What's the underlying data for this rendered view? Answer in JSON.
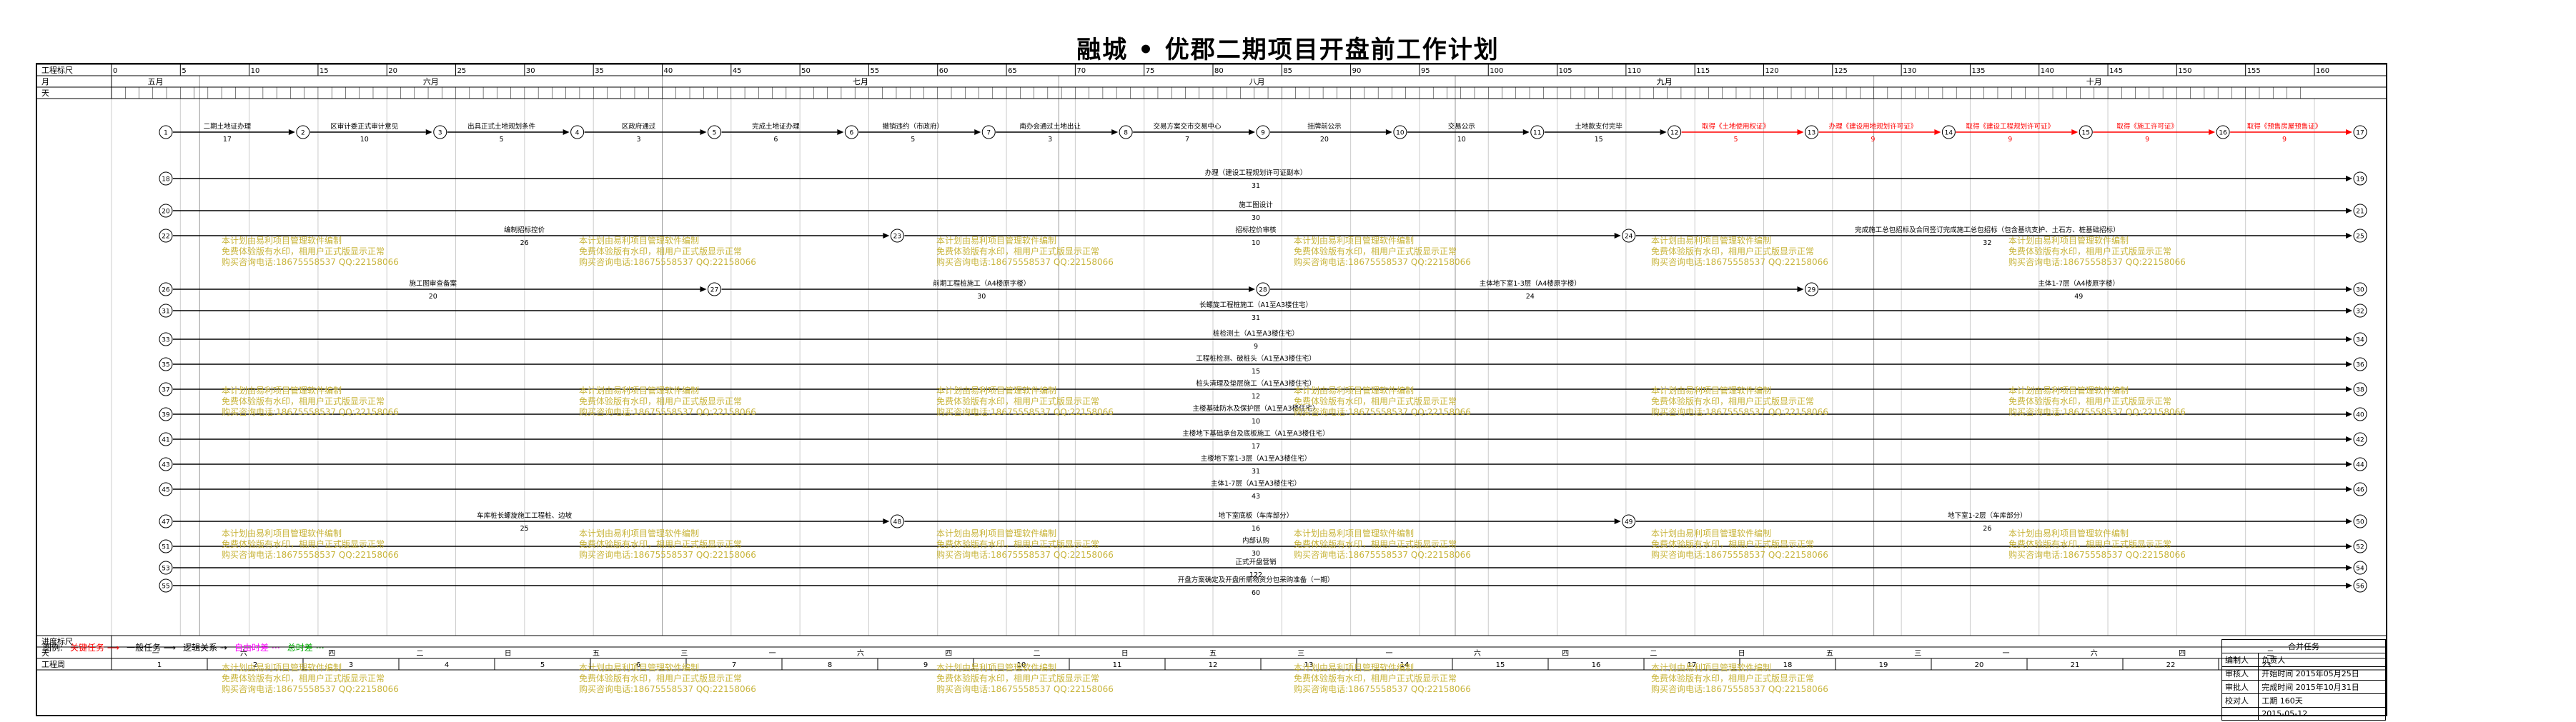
{
  "title": "融城 • 优郡二期项目开盘前工作计划",
  "header": {
    "row_labels": [
      "工程标尺",
      "月",
      "天"
    ],
    "months": [
      "五月",
      "六月",
      "七月",
      "八月",
      "九月",
      "十月"
    ],
    "ruler_ticks": [
      "0",
      "5",
      "10",
      "15",
      "20",
      "25",
      "30",
      "35",
      "40",
      "45",
      "50",
      "55",
      "60",
      "65",
      "70",
      "75",
      "80",
      "85",
      "90",
      "95",
      "100",
      "105",
      "110",
      "115",
      "120",
      "125",
      "130",
      "135",
      "140",
      "145",
      "150",
      "155",
      "160"
    ]
  },
  "footer": {
    "row_labels": [
      "进度标尺",
      "天",
      "工程周"
    ],
    "weekdays": [
      "一",
      "六",
      "四",
      "二",
      "日",
      "五",
      "三",
      "一",
      "六",
      "四",
      "二",
      "日",
      "五",
      "三",
      "一",
      "六",
      "四",
      "二",
      "日",
      "五",
      "三",
      "一",
      "六",
      "四",
      "二"
    ],
    "weeks": [
      "1",
      "2",
      "3",
      "4",
      "5",
      "6",
      "7",
      "8",
      "9",
      "10",
      "11",
      "12",
      "13",
      "14",
      "15",
      "16",
      "17",
      "18",
      "19",
      "20",
      "21",
      "22",
      "23"
    ]
  },
  "tasks": [
    {
      "label": "二期土地证办理",
      "days": "17",
      "critical": false
    },
    {
      "label": "区审计委正式审计意见",
      "days": "10",
      "critical": false
    },
    {
      "label": "出具正式土地规划条件",
      "days": "5",
      "critical": false
    },
    {
      "label": "区政府通过",
      "days": "3",
      "critical": false
    },
    {
      "label": "完成土地证办理",
      "days": "6",
      "critical": false
    },
    {
      "label": "撤销违约（市政府）",
      "days": "5",
      "critical": false
    },
    {
      "label": "南办会通过土地出让",
      "days": "3",
      "critical": false
    },
    {
      "label": "交易方案交市交易中心",
      "days": "7",
      "critical": false
    },
    {
      "label": "挂牌前公示",
      "days": "20",
      "critical": false
    },
    {
      "label": "交易公示",
      "days": "10",
      "critical": false
    },
    {
      "label": "土地款支付完毕",
      "days": "15",
      "critical": false
    },
    {
      "label": "取得《土地使用权证》",
      "days": "5",
      "critical": true
    },
    {
      "label": "办理《建设用地规划许可证》",
      "days": "9",
      "critical": true
    },
    {
      "label": "取得《建设工程规划许可证》",
      "days": "9",
      "critical": true
    },
    {
      "label": "取得《施工许可证》",
      "days": "9",
      "critical": true
    },
    {
      "label": "取得《预售房屋预售证》",
      "days": "9",
      "critical": true
    },
    {
      "label": "办理（建设工程规划许可证副本）",
      "days": "31",
      "critical": false
    },
    {
      "label": "施工图设计",
      "days": "30",
      "critical": false
    },
    {
      "label": "编制招标控价",
      "days": "26",
      "critical": false
    },
    {
      "label": "招标控价审核",
      "days": "10",
      "critical": false
    },
    {
      "label": "完成施工总包招标及合同签订完成施工总包招标（包含基坑支护、土石方、桩基础招标）",
      "days": "32",
      "critical": false
    },
    {
      "label": "施工图审查备案",
      "days": "20",
      "critical": false
    },
    {
      "label": "前期工程桩施工（A4楼原字楼）",
      "days": "30",
      "critical": false
    },
    {
      "label": "主体地下室1-3层（A4楼原字楼）",
      "days": "24",
      "critical": false
    },
    {
      "label": "主体1-7层（A4楼原字楼）",
      "days": "49",
      "critical": false
    },
    {
      "label": "长螺旋工程桩施工（A1至A3楼住宅）",
      "days": "31",
      "critical": false
    },
    {
      "label": "桩检测土（A1至A3楼住宅）",
      "days": "9",
      "critical": false
    },
    {
      "label": "工程桩检测、破桩头（A1至A3楼住宅）",
      "days": "15",
      "critical": false
    },
    {
      "label": "桩头清理及垫层施工（A1至A3楼住宅）",
      "days": "12",
      "critical": false
    },
    {
      "label": "主楼基础防水及保护层（A1至A3楼住宅）",
      "days": "10",
      "critical": false
    },
    {
      "label": "主楼地下基础承台及底板施工（A1至A3楼住宅）",
      "days": "17",
      "critical": false
    },
    {
      "label": "主楼地下室1-3层（A1至A3楼住宅）",
      "days": "31",
      "critical": false
    },
    {
      "label": "主体1-7层（A1至A3楼住宅）",
      "days": "43",
      "critical": false
    },
    {
      "label": "车库桩长螺旋施工工程桩、边坡",
      "days": "25",
      "critical": false
    },
    {
      "label": "地下室底板（车库部分）",
      "days": "16",
      "critical": false
    },
    {
      "label": "地下室1-2层（车库部分）",
      "days": "26",
      "critical": false
    },
    {
      "label": "内部认购",
      "days": "30",
      "critical": false
    },
    {
      "label": "正式开盘营销",
      "days": "122",
      "critical": false
    },
    {
      "label": "开盘方案确定及开盘所需物资分包采购准备（一期）",
      "days": "60",
      "critical": false
    }
  ],
  "watermark": [
    "本计划由易利项目管理软件编制",
    "免费体验版有水印，相用户正式版显示正常",
    "购买咨询电话:18675558537 QQ:22158066"
  ],
  "legend": {
    "label": "图例:",
    "items": [
      "关键任务",
      "一般任务",
      "逻辑关系",
      "自由时差",
      "总时差"
    ],
    "colors": {
      "critical": "#ff0000",
      "normal": "#000000",
      "free_float": "#ff00ff",
      "total_float": "#00cc00"
    }
  },
  "signoff": {
    "header": "合并任务",
    "rows": [
      [
        "编制人",
        "负责人"
      ],
      [
        "审核人",
        "开始时间  2015年05月25日"
      ],
      [
        "审批人",
        "完成时间  2015年10月31日"
      ],
      [
        "校对人",
        "工期  160天"
      ],
      [
        "",
        "2015-05-12"
      ]
    ]
  }
}
